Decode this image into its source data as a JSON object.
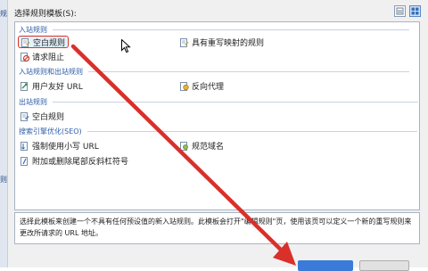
{
  "dialog": {
    "list_label": "选择规则模板(S):",
    "description": "选择此模板来创建一个不具有任何预设值的新入站规则。此模板会打开\"编辑规则\"页，使用该页可以定义一个新的重写规则来更改所请求的 URL 地址。"
  },
  "left_panel": {
    "fragment_top": "规",
    "fragment_bottom": "则"
  },
  "groups": {
    "inbound": "入站规则",
    "in_out": "入站规则和出站规则",
    "outbound": "出站规则",
    "seo": "搜索引擎优化(SEO)"
  },
  "items": {
    "blank_rule": "空白规则",
    "rewrite_map": "具有重写映射的规则",
    "request_block": "请求阻止",
    "friendly_url": "用户友好 URL",
    "reverse_proxy": "反向代理",
    "blank_outbound": "空白规则",
    "lowercase_url": "强制使用小写 URL",
    "canonical_domain": "规范域名",
    "trailing_slash": "附加或删除尾部反斜杠符号"
  },
  "colors": {
    "annotation_red": "#d9302a",
    "group_header": "#2f5fa8",
    "selection_bg": "#e5f1fb",
    "ok_button": "#3b7ad9"
  },
  "icons": {
    "rule": "rule-document-icon",
    "block": "block-icon",
    "friendly": "friendly-url-icon",
    "proxy": "reverse-proxy-icon",
    "view_list": "view-list-icon",
    "view_grid": "view-grid-icon"
  }
}
